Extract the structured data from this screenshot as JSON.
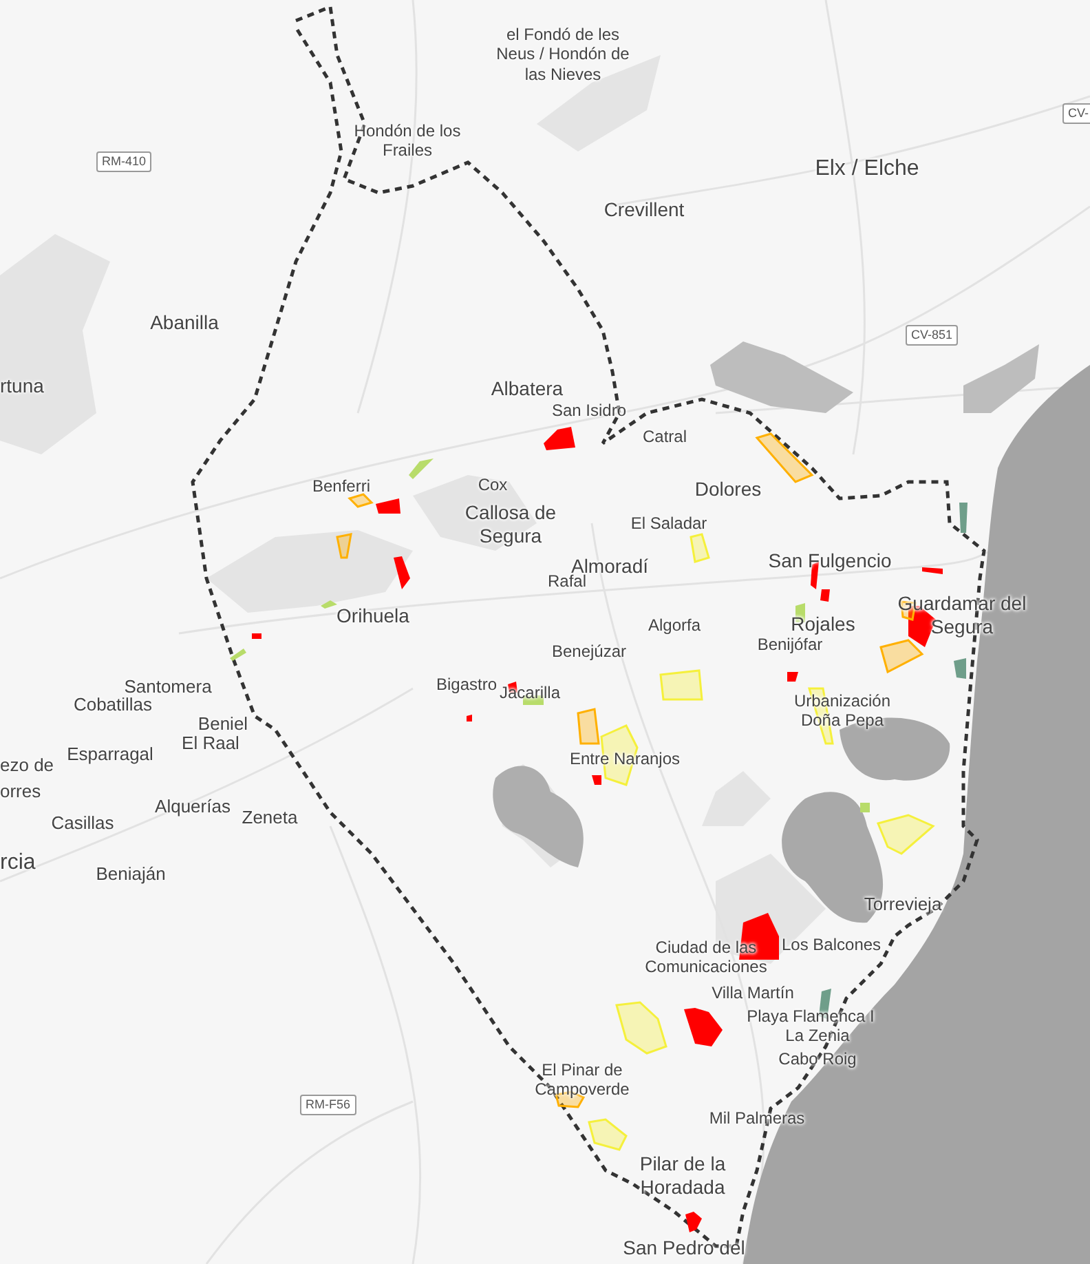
{
  "places": [
    {
      "name": "el Fondó de les Neus / Hondón de las Nieves"
    },
    {
      "name": "Hondón de los Frailes"
    },
    {
      "name": "Elx / Elche"
    },
    {
      "name": "Crevillent"
    },
    {
      "name": "Abanilla"
    },
    {
      "name": "rtuna"
    },
    {
      "name": "Albatera"
    },
    {
      "name": "San Isidro"
    },
    {
      "name": "Catral"
    },
    {
      "name": "Benferri"
    },
    {
      "name": "Cox"
    },
    {
      "name": "Dolores"
    },
    {
      "name": "Callosa de Segura"
    },
    {
      "name": "El Saladar"
    },
    {
      "name": "Almoradí"
    },
    {
      "name": "San Fulgencio"
    },
    {
      "name": "Rafal"
    },
    {
      "name": "Orihuela"
    },
    {
      "name": "Algorfa"
    },
    {
      "name": "Rojales"
    },
    {
      "name": "Guardamar del Segura"
    },
    {
      "name": "Benejúzar"
    },
    {
      "name": "Benijófar"
    },
    {
      "name": "Santomera"
    },
    {
      "name": "Bigastro"
    },
    {
      "name": "Jacarilla"
    },
    {
      "name": "Cobatillas"
    },
    {
      "name": "Beniel"
    },
    {
      "name": "Urbanización Doña Pepa"
    },
    {
      "name": "El Raal"
    },
    {
      "name": "Esparragal"
    },
    {
      "name": "ezo de"
    },
    {
      "name": "orres"
    },
    {
      "name": "Entre Naranjos"
    },
    {
      "name": "Alquerías"
    },
    {
      "name": "Casillas"
    },
    {
      "name": "Zeneta"
    },
    {
      "name": "rcia"
    },
    {
      "name": "Beniaján"
    },
    {
      "name": "Torrevieja"
    },
    {
      "name": "Ciudad de las Comunicaciones"
    },
    {
      "name": "Los Balcones"
    },
    {
      "name": "Villa Martín"
    },
    {
      "name": "Playa Flamenca I"
    },
    {
      "name": "La Zenia"
    },
    {
      "name": "Cabo Roig"
    },
    {
      "name": "El Pinar de Campoverde"
    },
    {
      "name": "Mil Palmeras"
    },
    {
      "name": "Pilar de la Horadada"
    },
    {
      "name": "San Pedro del"
    }
  ],
  "roads": [
    {
      "name": "CV-"
    },
    {
      "name": "RM-410"
    },
    {
      "name": "CV-851"
    },
    {
      "name": "RM-F56"
    }
  ],
  "zones": [
    {
      "color": "#ff0000",
      "kind": "solid"
    },
    {
      "color": "#ffb000",
      "kind": "hatched"
    },
    {
      "color": "#b8dc6a",
      "kind": "solid"
    },
    {
      "color": "#ffb000",
      "kind": "hatched"
    },
    {
      "color": "#ff0000",
      "kind": "solid"
    },
    {
      "color": "#ffb000",
      "kind": "hatched"
    },
    {
      "color": "#ff0000",
      "kind": "solid"
    },
    {
      "color": "#b8dc6a",
      "kind": "solid"
    },
    {
      "color": "#b8dc6a",
      "kind": "solid"
    },
    {
      "color": "#ff0000",
      "kind": "solid"
    },
    {
      "color": "#f5f03c",
      "kind": "hatched"
    },
    {
      "color": "#ff0000",
      "kind": "solid"
    },
    {
      "color": "#ff0000",
      "kind": "solid"
    },
    {
      "color": "#b8dc6a",
      "kind": "solid"
    },
    {
      "color": "#ff0000",
      "kind": "solid"
    },
    {
      "color": "#ffb000",
      "kind": "hatched"
    },
    {
      "color": "#ffb000",
      "kind": "hatched"
    },
    {
      "color": "#ff0000",
      "kind": "solid"
    },
    {
      "color": "#f5f03c",
      "kind": "hatched"
    },
    {
      "color": "#f5f03c",
      "kind": "hatched"
    },
    {
      "color": "#ffb000",
      "kind": "hatched"
    },
    {
      "color": "#f5f03c",
      "kind": "hatched"
    },
    {
      "color": "#ff0000",
      "kind": "solid"
    },
    {
      "color": "#6f9e8a",
      "kind": "solid"
    },
    {
      "color": "#6f9e8a",
      "kind": "solid"
    },
    {
      "color": "#b8dc6a",
      "kind": "solid"
    },
    {
      "color": "#f5f03c",
      "kind": "hatched"
    },
    {
      "color": "#ff0000",
      "kind": "solid"
    },
    {
      "color": "#f5f03c",
      "kind": "hatched"
    },
    {
      "color": "#ff0000",
      "kind": "solid"
    },
    {
      "color": "#ffb000",
      "kind": "hatched"
    },
    {
      "color": "#f5f03c",
      "kind": "hatched"
    },
    {
      "color": "#ff0000",
      "kind": "solid"
    },
    {
      "color": "#6f9e8a",
      "kind": "solid"
    },
    {
      "color": "#ff0000",
      "kind": "solid"
    },
    {
      "color": "#b8dc6a",
      "kind": "solid"
    },
    {
      "color": "#ff0000",
      "kind": "solid"
    },
    {
      "color": "#ff0000",
      "kind": "solid"
    }
  ]
}
